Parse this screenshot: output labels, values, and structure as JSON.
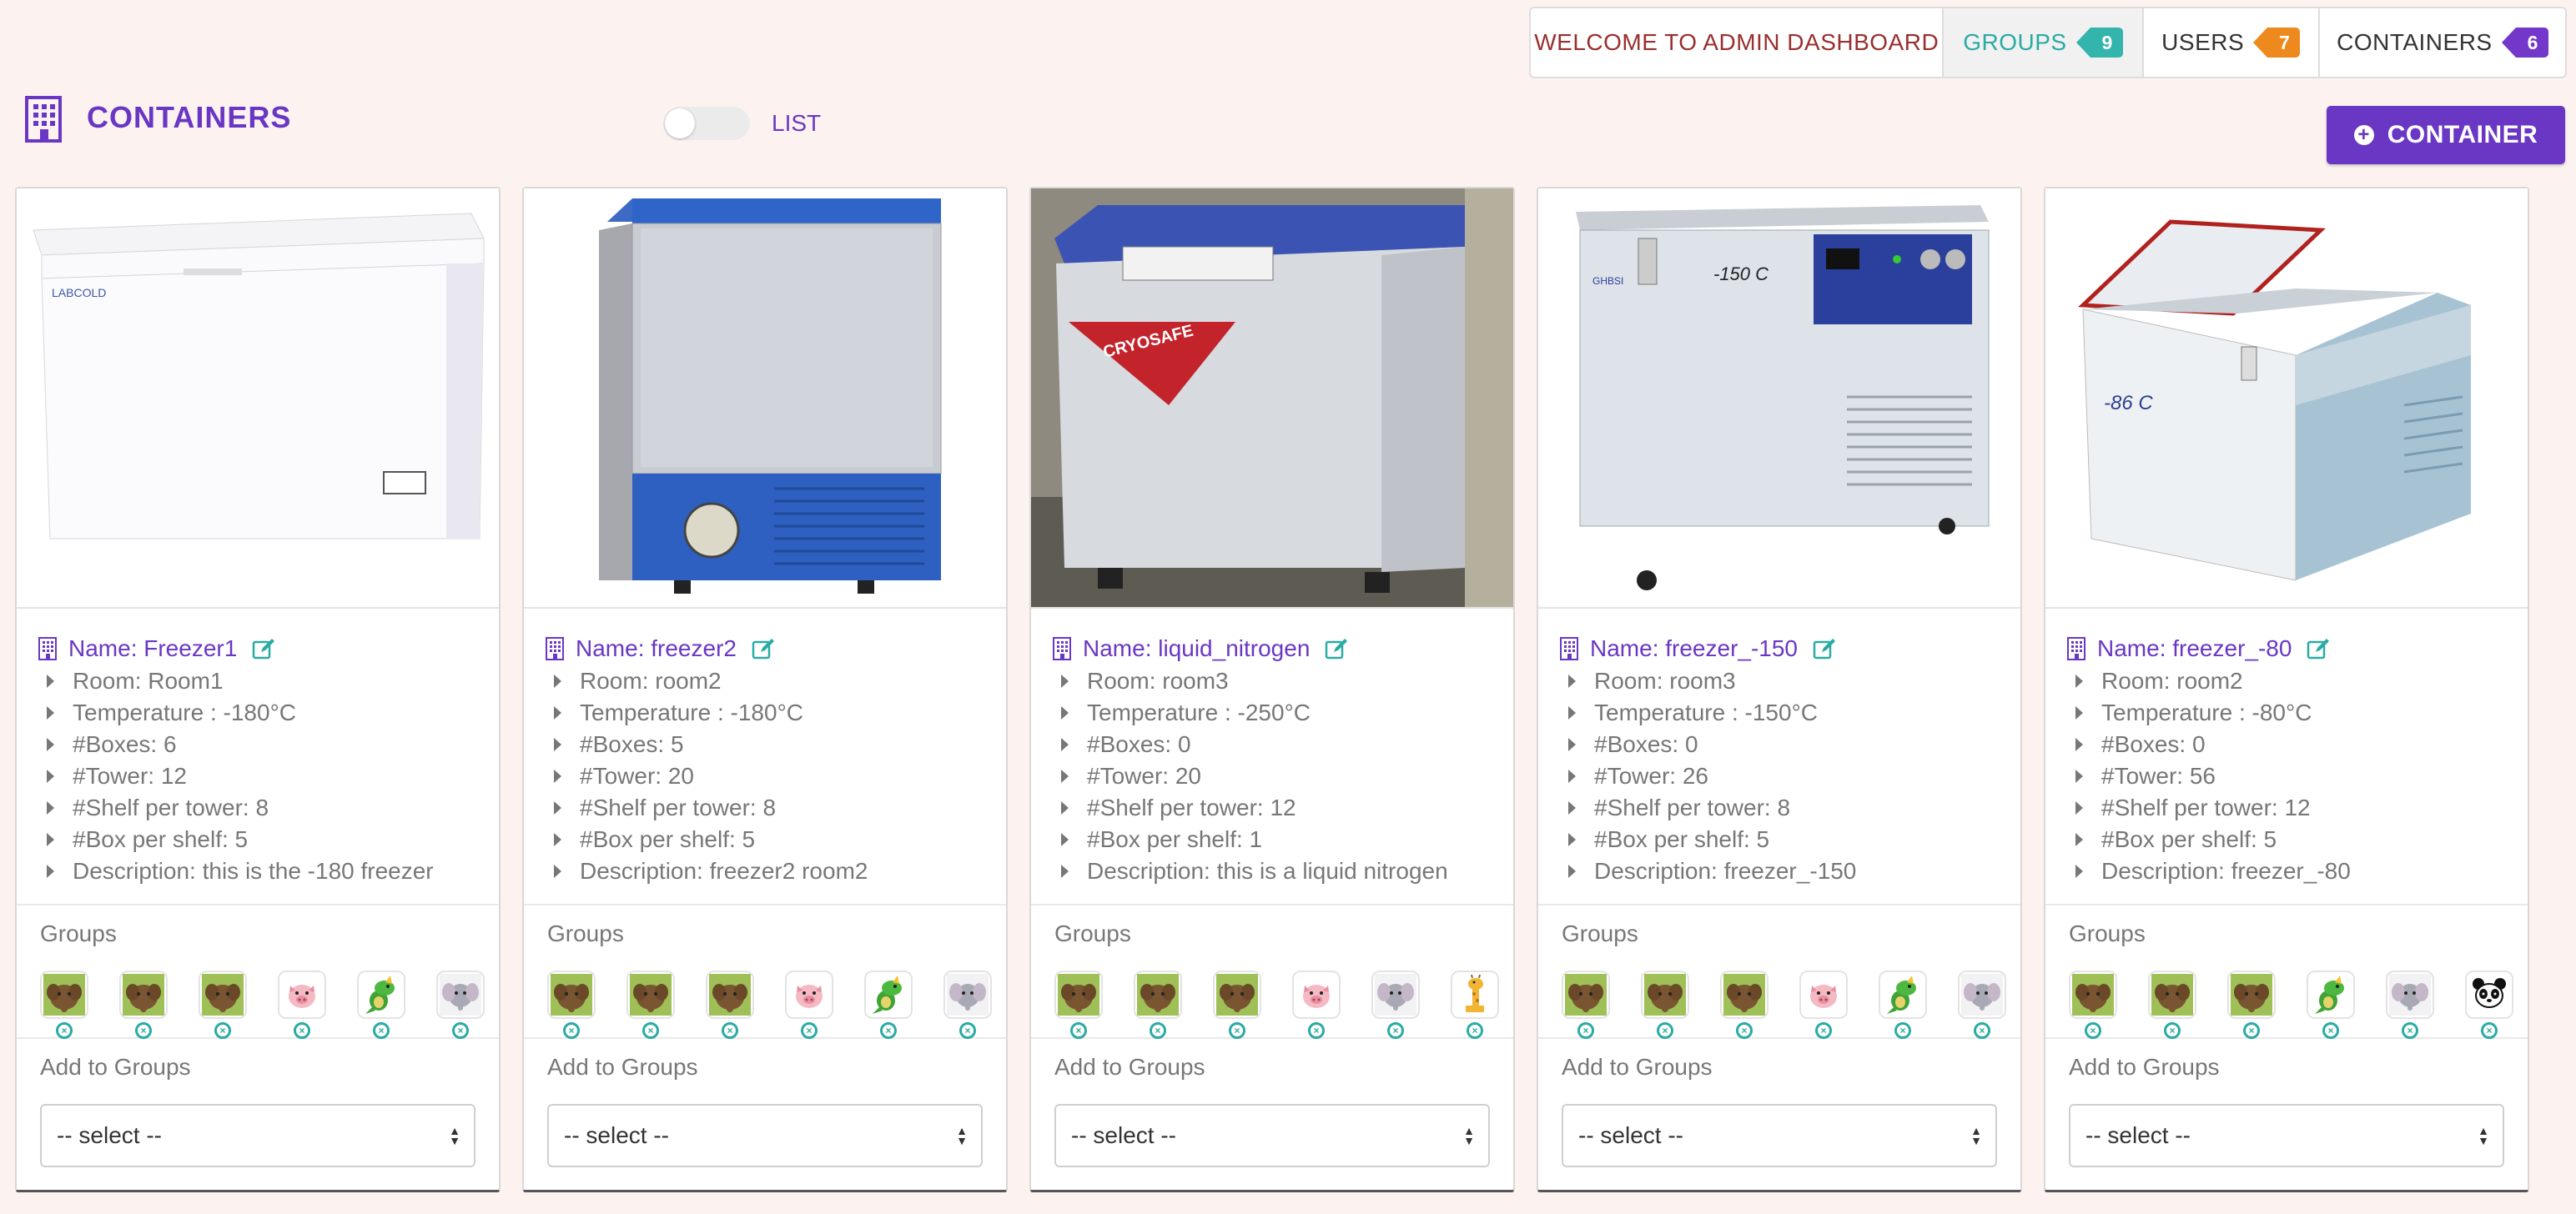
{
  "nav": {
    "welcome": "WELCOME TO ADMIN DASHBOARD",
    "groups_label": "GROUPS",
    "groups_count": "9",
    "users_label": "USERS",
    "users_count": "7",
    "containers_label": "CONTAINERS",
    "containers_count": "6"
  },
  "header": {
    "title": "CONTAINERS",
    "toggle_label": "LIST",
    "add_button": "CONTAINER"
  },
  "colors": {
    "primary": "#6a37c4",
    "teal": "#2aaba4",
    "orange": "#ee8a1d",
    "background": "#fcf3f1"
  },
  "cards": [
    {
      "name": "Name: Freezer1",
      "attrs": [
        "Room: Room1",
        "Temperature : -180°C",
        "#Boxes: 6",
        "#Tower: 12",
        "#Shelf per tower: 8",
        "#Box per shelf: 5",
        "Description: this is the -180 freezer"
      ],
      "groups_label": "Groups",
      "groups": [
        "elephant-brown",
        "elephant-brown",
        "elephant-brown",
        "pig",
        "dragon",
        "elephant-grey"
      ],
      "add_label": "Add to Groups",
      "select_value": "-- select --"
    },
    {
      "name": "Name: freezer2",
      "attrs": [
        "Room: room2",
        "Temperature : -180°C",
        "#Boxes: 5",
        "#Tower: 20",
        "#Shelf per tower: 8",
        "#Box per shelf: 5",
        "Description: freezer2 room2"
      ],
      "groups_label": "Groups",
      "groups": [
        "elephant-brown",
        "elephant-brown",
        "elephant-brown",
        "pig",
        "dragon",
        "elephant-grey"
      ],
      "add_label": "Add to Groups",
      "select_value": "-- select --"
    },
    {
      "name": "Name: liquid_nitrogen",
      "attrs": [
        "Room: room3",
        "Temperature : -250°C",
        "#Boxes: 0",
        "#Tower: 20",
        "#Shelf per tower: 12",
        "#Box per shelf: 1",
        "Description: this is a liquid nitrogen"
      ],
      "groups_label": "Groups",
      "groups": [
        "elephant-brown",
        "elephant-brown",
        "elephant-brown",
        "pig",
        "elephant-grey",
        "giraffe"
      ],
      "add_label": "Add to Groups",
      "select_value": "-- select --"
    },
    {
      "name": "Name: freezer_-150",
      "attrs": [
        "Room: room3",
        "Temperature : -150°C",
        "#Boxes: 0",
        "#Tower: 26",
        "#Shelf per tower: 8",
        "#Box per shelf: 5",
        "Description: freezer_-150"
      ],
      "groups_label": "Groups",
      "groups": [
        "elephant-brown",
        "elephant-brown",
        "elephant-brown",
        "pig",
        "dragon",
        "elephant-grey"
      ],
      "add_label": "Add to Groups",
      "select_value": "-- select --"
    },
    {
      "name": "Name: freezer_-80",
      "attrs": [
        "Room: room2",
        "Temperature : -80°C",
        "#Boxes: 0",
        "#Tower: 56",
        "#Shelf per tower: 12",
        "#Box per shelf: 5",
        "Description: freezer_-80"
      ],
      "groups_label": "Groups",
      "groups": [
        "elephant-brown",
        "elephant-brown",
        "elephant-brown",
        "dragon",
        "elephant-grey",
        "panda"
      ],
      "add_label": "Add to Groups",
      "select_value": "-- select --"
    }
  ]
}
